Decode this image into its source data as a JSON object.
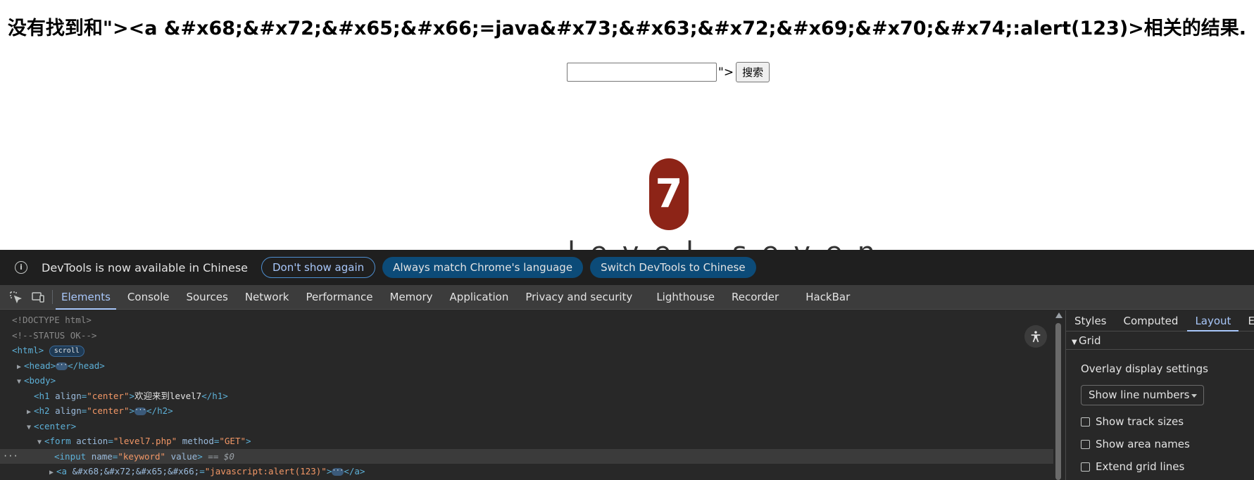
{
  "page": {
    "heading": "没有找到和\"><a &#x68;&#x72;&#x65;&#x66;=java&#x73;&#x63;&#x72;&#x69;&#x70;&#x74;:alert(123)>相关的结果.",
    "search_value": "",
    "stray_text": "\">",
    "search_button": "搜索",
    "badge_number": "7",
    "level_caption": "level seven"
  },
  "devtools": {
    "infobar": {
      "message": "DevTools is now available in Chinese",
      "dont_show": "Don't show again",
      "match_language": "Always match Chrome's language",
      "switch_language": "Switch DevTools to Chinese"
    },
    "tabs": [
      "Elements",
      "Console",
      "Sources",
      "Network",
      "Performance",
      "Memory",
      "Application",
      "Privacy and security",
      "Lighthouse",
      "Recorder",
      "HackBar"
    ],
    "active_tab": "Elements",
    "dom": {
      "doctype": "<!DOCTYPE html>",
      "comment": "<!--STATUS OK-->",
      "html_open": "<html>",
      "scroll_badge": "scroll",
      "head_open": "<head>",
      "head_close": "</head>",
      "body_open": "<body>",
      "h1_open": "<h1 ",
      "h1_attr": "align",
      "h1_val": "\"center\"",
      "h1_text": "欢迎来到level7",
      "h1_close": "</h1>",
      "h2_open": "<h2 ",
      "h2_attr": "align",
      "h2_val": "\"center\"",
      "h2_close": "</h2>",
      "center_open": "<center>",
      "form_open": "<form ",
      "form_attr1": "action",
      "form_val1": "\"level7.php\"",
      "form_attr2": "method",
      "form_val2": "\"GET\"",
      "input_open": "<input ",
      "input_attr1": "name",
      "input_val1": "\"keyword\"",
      "input_attr2": "value",
      "input_eq": "== $0",
      "a_open": "<a ",
      "a_attr": "&#x68;&#x72;&#x65;&#x66;",
      "a_val": "\"javascript:alert(123)\"",
      "a_close": "</a>"
    },
    "sidebar": {
      "tabs": [
        "Styles",
        "Computed",
        "Layout",
        "Ev"
      ],
      "active_tab": "Layout",
      "section": "Grid",
      "overlay_title": "Overlay display settings",
      "select_value": "Show line numbers",
      "checks": [
        "Show track sizes",
        "Show area names",
        "Extend grid lines"
      ]
    }
  }
}
